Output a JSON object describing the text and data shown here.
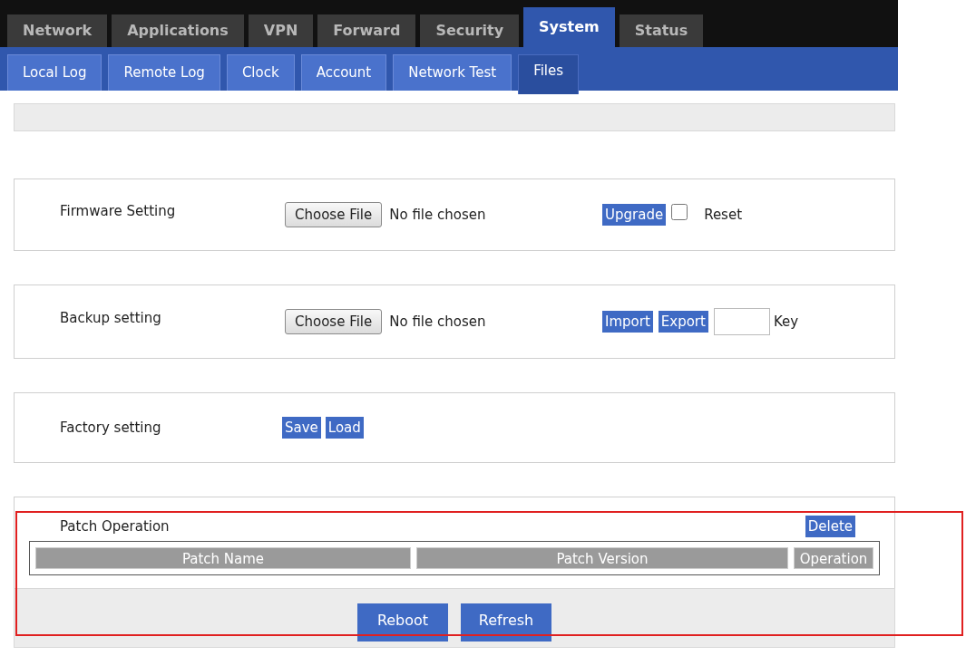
{
  "tabs": [
    {
      "label": "Network",
      "selected": false
    },
    {
      "label": "Applications",
      "selected": false
    },
    {
      "label": "VPN",
      "selected": false
    },
    {
      "label": "Forward",
      "selected": false
    },
    {
      "label": "Security",
      "selected": false
    },
    {
      "label": "System",
      "selected": true
    },
    {
      "label": "Status",
      "selected": false
    }
  ],
  "subtabs": [
    {
      "label": "Local Log",
      "selected": false
    },
    {
      "label": "Remote Log",
      "selected": false
    },
    {
      "label": "Clock",
      "selected": false
    },
    {
      "label": "Account",
      "selected": false
    },
    {
      "label": "Network Test",
      "selected": false
    },
    {
      "label": "Files",
      "selected": true
    }
  ],
  "sections": [
    {
      "kind": "firmware",
      "label": "Firmware Setting",
      "file_button": "Choose File",
      "file_status": "No file chosen",
      "upgrade_button": "Upgrade",
      "reset": {
        "label": "Reset",
        "checked": false
      }
    },
    {
      "kind": "backup",
      "label": "Backup setting",
      "file_button": "Choose File",
      "file_status": "No file chosen",
      "buttons": [
        "Import",
        "Export"
      ],
      "key_label": "Key"
    },
    {
      "kind": "factory",
      "label": "Factory setting",
      "buttons": [
        "Save",
        "Load"
      ]
    },
    {
      "kind": "patch",
      "label": "Patch Operation",
      "delete_button": "Delete",
      "columns": [
        "Patch Name",
        "Patch Version",
        "Operation"
      ]
    }
  ],
  "footer_buttons": [
    "Reboot",
    "Refresh"
  ]
}
